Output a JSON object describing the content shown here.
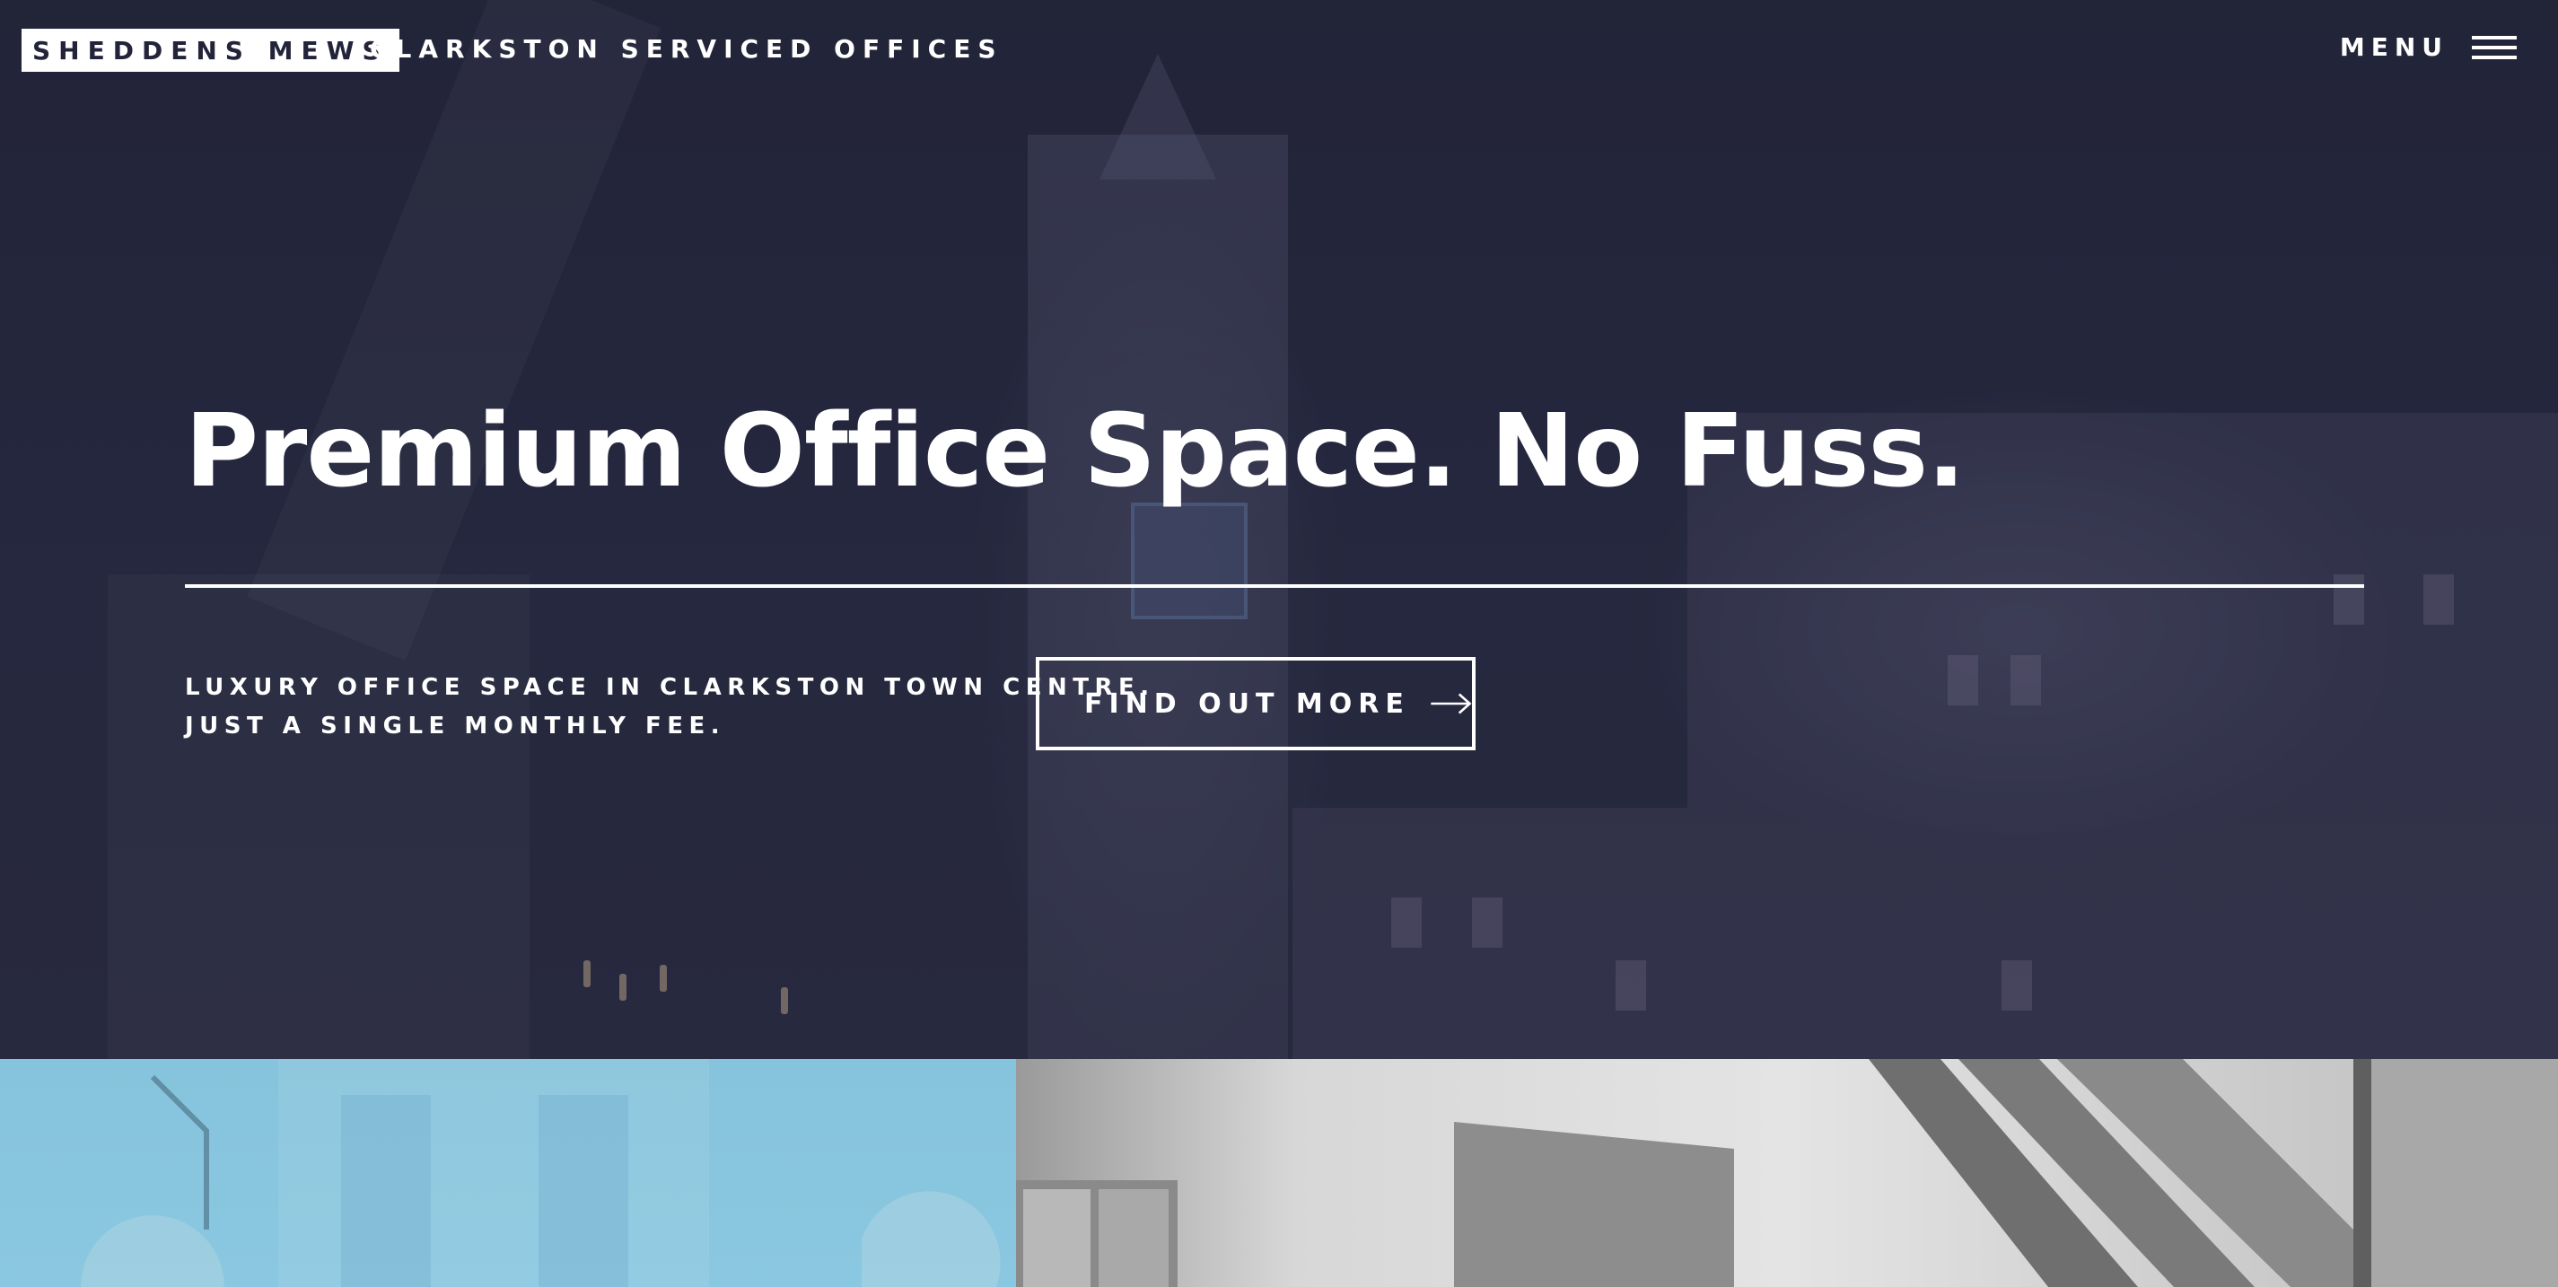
{
  "header": {
    "logo_text": "SHEDDENS MEWS",
    "tagline": "CLARKSTON SERVICED OFFICES",
    "menu_label": "MENU",
    "menu_icon": "hamburger-icon"
  },
  "hero": {
    "headline": "Premium Office Space. No Fuss.",
    "subline_1": "LUXURY OFFICE SPACE IN CLARKSTON TOWN CENTRE.",
    "subline_2": "JUST A SINGLE MONTHLY FEE.",
    "cta_label": "FIND OUT MORE",
    "cta_icon": "arrow-right-icon"
  },
  "colors": {
    "hero_overlay": "#23243a",
    "logo_background": "#ffffff",
    "panel_left": "#8ac7e0",
    "panel_right": "#d7d7d7"
  }
}
